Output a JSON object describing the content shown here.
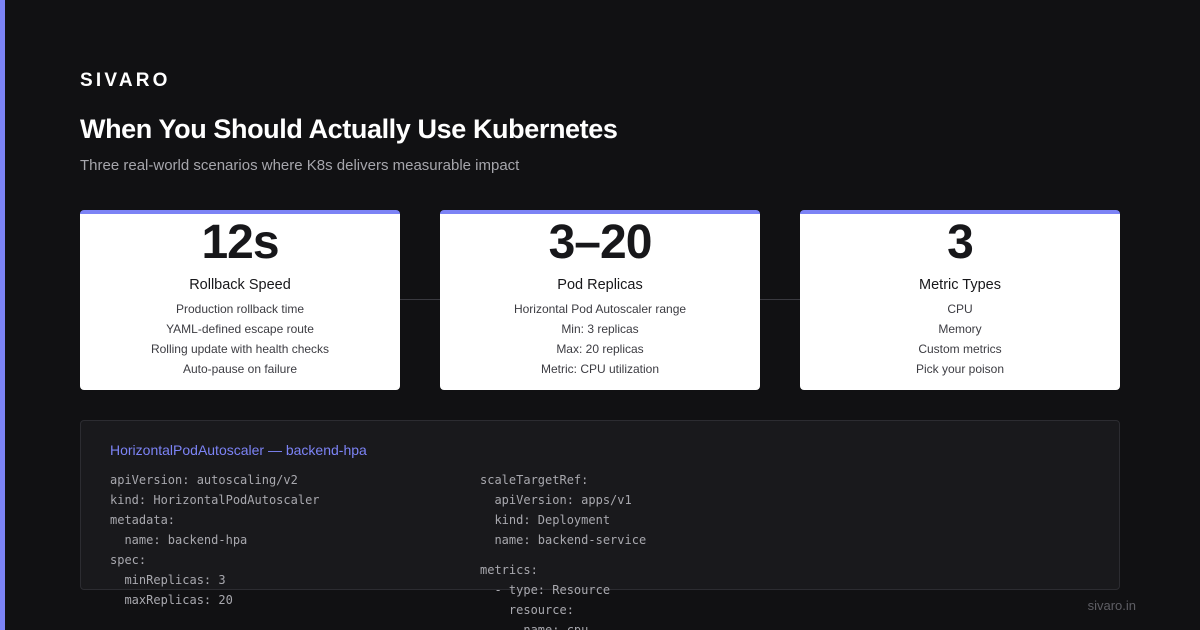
{
  "brand": "SIVARO",
  "title": "When You Should Actually Use Kubernetes",
  "subtitle": "Three real-world scenarios where K8s delivers measurable impact",
  "cards": [
    {
      "stat": "12s",
      "label": "Rollback Speed",
      "details": [
        "Production rollback time",
        "YAML-defined escape route",
        "Rolling update with health checks",
        "Auto-pause on failure"
      ]
    },
    {
      "stat": "3–20",
      "label": "Pod Replicas",
      "details": [
        "Horizontal Pod Autoscaler range",
        "Min: 3 replicas",
        "Max: 20 replicas",
        "Metric: CPU utilization"
      ]
    },
    {
      "stat": "3",
      "label": "Metric Types",
      "details": [
        "CPU",
        "Memory",
        "Custom metrics",
        "Pick your poison"
      ]
    }
  ],
  "code": {
    "title": "HorizontalPodAutoscaler — backend-hpa",
    "left_lines": [
      "apiVersion: autoscaling/v2",
      "kind: HorizontalPodAutoscaler",
      "metadata:",
      "  name: backend-hpa",
      "spec:",
      "  minReplicas: 3",
      "  maxReplicas: 20"
    ],
    "right_lines": [
      "scaleTargetRef:",
      "  apiVersion: apps/v1",
      "  kind: Deployment",
      "  name: backend-service",
      "metrics:",
      "  - type: Resource",
      "    resource:",
      "      name: cpu"
    ]
  },
  "footer": {
    "domain": "sivaro.in"
  },
  "colors": {
    "background": "#111113",
    "accent": "#7c83f5",
    "card_background": "#ffffff",
    "muted_text": "#a6a6ac"
  }
}
